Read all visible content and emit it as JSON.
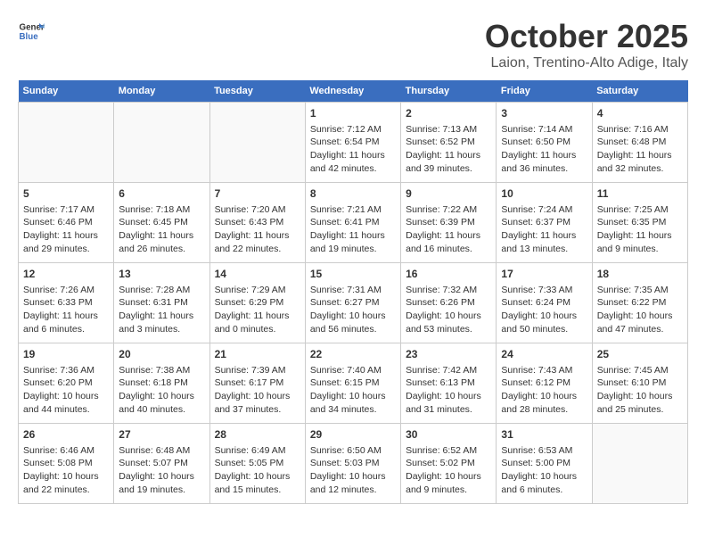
{
  "header": {
    "logo_line1": "General",
    "logo_line2": "Blue",
    "month": "October 2025",
    "location": "Laion, Trentino-Alto Adige, Italy"
  },
  "days_of_week": [
    "Sunday",
    "Monday",
    "Tuesday",
    "Wednesday",
    "Thursday",
    "Friday",
    "Saturday"
  ],
  "weeks": [
    {
      "cells": [
        {
          "day": null,
          "content": ""
        },
        {
          "day": null,
          "content": ""
        },
        {
          "day": null,
          "content": ""
        },
        {
          "day": "1",
          "content": "Sunrise: 7:12 AM\nSunset: 6:54 PM\nDaylight: 11 hours and 42 minutes."
        },
        {
          "day": "2",
          "content": "Sunrise: 7:13 AM\nSunset: 6:52 PM\nDaylight: 11 hours and 39 minutes."
        },
        {
          "day": "3",
          "content": "Sunrise: 7:14 AM\nSunset: 6:50 PM\nDaylight: 11 hours and 36 minutes."
        },
        {
          "day": "4",
          "content": "Sunrise: 7:16 AM\nSunset: 6:48 PM\nDaylight: 11 hours and 32 minutes."
        }
      ]
    },
    {
      "cells": [
        {
          "day": "5",
          "content": "Sunrise: 7:17 AM\nSunset: 6:46 PM\nDaylight: 11 hours and 29 minutes."
        },
        {
          "day": "6",
          "content": "Sunrise: 7:18 AM\nSunset: 6:45 PM\nDaylight: 11 hours and 26 minutes."
        },
        {
          "day": "7",
          "content": "Sunrise: 7:20 AM\nSunset: 6:43 PM\nDaylight: 11 hours and 22 minutes."
        },
        {
          "day": "8",
          "content": "Sunrise: 7:21 AM\nSunset: 6:41 PM\nDaylight: 11 hours and 19 minutes."
        },
        {
          "day": "9",
          "content": "Sunrise: 7:22 AM\nSunset: 6:39 PM\nDaylight: 11 hours and 16 minutes."
        },
        {
          "day": "10",
          "content": "Sunrise: 7:24 AM\nSunset: 6:37 PM\nDaylight: 11 hours and 13 minutes."
        },
        {
          "day": "11",
          "content": "Sunrise: 7:25 AM\nSunset: 6:35 PM\nDaylight: 11 hours and 9 minutes."
        }
      ]
    },
    {
      "cells": [
        {
          "day": "12",
          "content": "Sunrise: 7:26 AM\nSunset: 6:33 PM\nDaylight: 11 hours and 6 minutes."
        },
        {
          "day": "13",
          "content": "Sunrise: 7:28 AM\nSunset: 6:31 PM\nDaylight: 11 hours and 3 minutes."
        },
        {
          "day": "14",
          "content": "Sunrise: 7:29 AM\nSunset: 6:29 PM\nDaylight: 11 hours and 0 minutes."
        },
        {
          "day": "15",
          "content": "Sunrise: 7:31 AM\nSunset: 6:27 PM\nDaylight: 10 hours and 56 minutes."
        },
        {
          "day": "16",
          "content": "Sunrise: 7:32 AM\nSunset: 6:26 PM\nDaylight: 10 hours and 53 minutes."
        },
        {
          "day": "17",
          "content": "Sunrise: 7:33 AM\nSunset: 6:24 PM\nDaylight: 10 hours and 50 minutes."
        },
        {
          "day": "18",
          "content": "Sunrise: 7:35 AM\nSunset: 6:22 PM\nDaylight: 10 hours and 47 minutes."
        }
      ]
    },
    {
      "cells": [
        {
          "day": "19",
          "content": "Sunrise: 7:36 AM\nSunset: 6:20 PM\nDaylight: 10 hours and 44 minutes."
        },
        {
          "day": "20",
          "content": "Sunrise: 7:38 AM\nSunset: 6:18 PM\nDaylight: 10 hours and 40 minutes."
        },
        {
          "day": "21",
          "content": "Sunrise: 7:39 AM\nSunset: 6:17 PM\nDaylight: 10 hours and 37 minutes."
        },
        {
          "day": "22",
          "content": "Sunrise: 7:40 AM\nSunset: 6:15 PM\nDaylight: 10 hours and 34 minutes."
        },
        {
          "day": "23",
          "content": "Sunrise: 7:42 AM\nSunset: 6:13 PM\nDaylight: 10 hours and 31 minutes."
        },
        {
          "day": "24",
          "content": "Sunrise: 7:43 AM\nSunset: 6:12 PM\nDaylight: 10 hours and 28 minutes."
        },
        {
          "day": "25",
          "content": "Sunrise: 7:45 AM\nSunset: 6:10 PM\nDaylight: 10 hours and 25 minutes."
        }
      ]
    },
    {
      "cells": [
        {
          "day": "26",
          "content": "Sunrise: 6:46 AM\nSunset: 5:08 PM\nDaylight: 10 hours and 22 minutes."
        },
        {
          "day": "27",
          "content": "Sunrise: 6:48 AM\nSunset: 5:07 PM\nDaylight: 10 hours and 19 minutes."
        },
        {
          "day": "28",
          "content": "Sunrise: 6:49 AM\nSunset: 5:05 PM\nDaylight: 10 hours and 15 minutes."
        },
        {
          "day": "29",
          "content": "Sunrise: 6:50 AM\nSunset: 5:03 PM\nDaylight: 10 hours and 12 minutes."
        },
        {
          "day": "30",
          "content": "Sunrise: 6:52 AM\nSunset: 5:02 PM\nDaylight: 10 hours and 9 minutes."
        },
        {
          "day": "31",
          "content": "Sunrise: 6:53 AM\nSunset: 5:00 PM\nDaylight: 10 hours and 6 minutes."
        },
        {
          "day": null,
          "content": ""
        }
      ]
    }
  ]
}
